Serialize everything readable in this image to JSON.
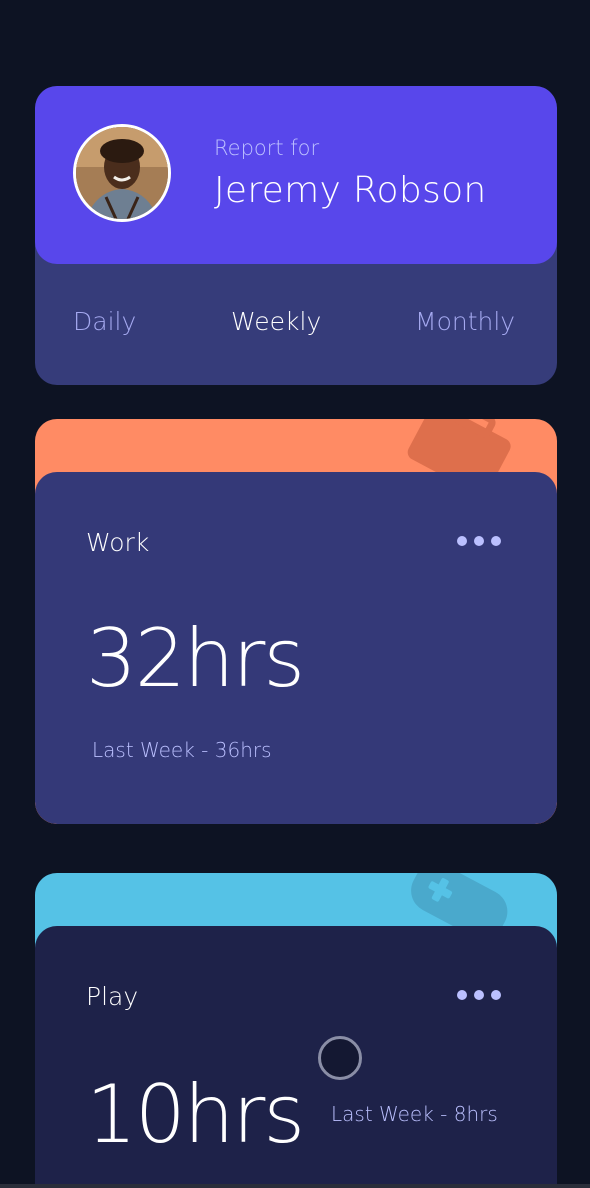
{
  "profile": {
    "report_for": "Report for",
    "name": "Jeremy Robson"
  },
  "tabs": [
    {
      "label": "Daily",
      "active": false
    },
    {
      "label": "Weekly",
      "active": true
    },
    {
      "label": "Monthly",
      "active": false
    }
  ],
  "activities": [
    {
      "title": "Work",
      "current": "32hrs",
      "previous": "Last Week - 36hrs",
      "accent": "#ff8b64",
      "icon": "briefcase-icon"
    },
    {
      "title": "Play",
      "current": "10hrs",
      "previous": "Last Week - 8hrs",
      "accent": "#55c2e6",
      "icon": "gamepad-icon"
    }
  ],
  "colors": {
    "background": "#0d1323",
    "primary": "#5847eb",
    "card": "#343978",
    "muted_text": "#bbc0ff"
  }
}
